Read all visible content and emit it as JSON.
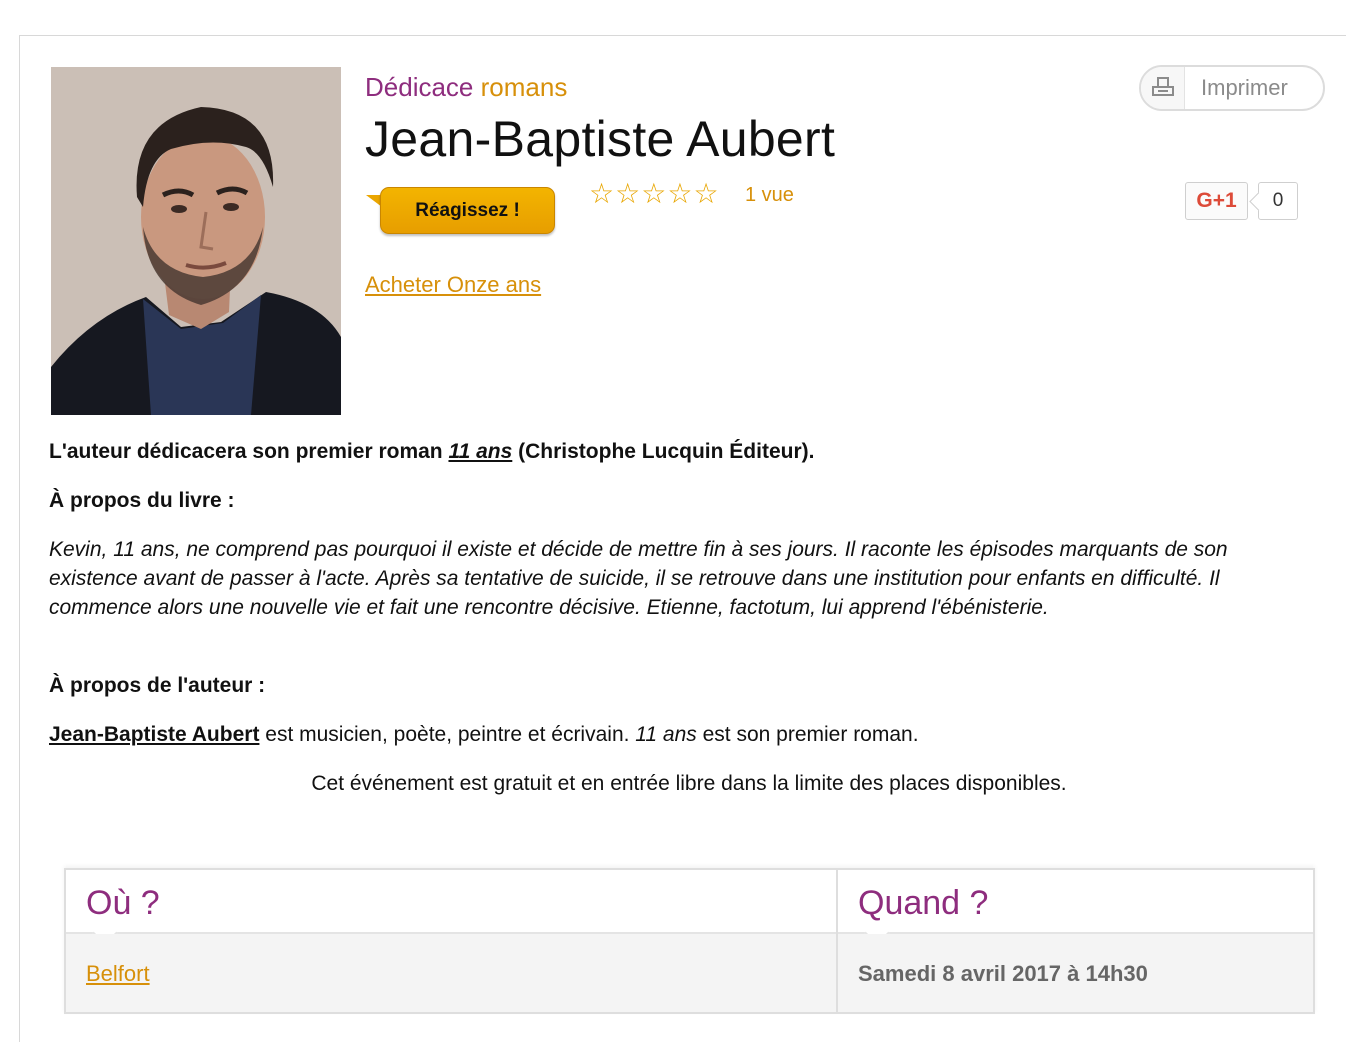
{
  "event": {
    "category_word1": "Dédicace",
    "category_word2": "romans",
    "title": "Jean-Baptiste Aubert",
    "react_label": "Réagissez !",
    "rating_stars": 5,
    "rating_filled": 0,
    "views_label": "1 vue",
    "buy_link": "Acheter Onze ans",
    "print_label": "Imprimer",
    "gplus_label": "G+1",
    "gplus_count": "0"
  },
  "content": {
    "intro_prefix": "L'auteur dédicacera son premier roman ",
    "intro_book": "11 ans",
    "intro_suffix": " (Christophe Lucquin Éditeur).",
    "about_book_heading": "À propos du livre :",
    "synopsis": "Kevin, 11 ans, ne comprend pas pourquoi il existe et décide de mettre fin à ses jours. Il raconte les épisodes marquants de son existence avant de passer à l'acte. Après sa tentative de suicide, il se retrouve dans une institution pour enfants en difficulté. Il commence alors une nouvelle vie et fait une rencontre décisive. Etienne, factotum, lui apprend l'ébénisterie.",
    "about_author_heading": "À propos de l'auteur :",
    "bio_author": "Jean-Baptiste Aubert",
    "bio_middle": " est musicien, poète, peintre et écrivain. ",
    "bio_book": "11 ans",
    "bio_suffix": " est son premier roman.",
    "free_notice": "Cet événement est gratuit et en entrée libre dans la limite des places disponibles."
  },
  "info": {
    "where_heading": "Où ?",
    "where_value": "Belfort",
    "when_heading": "Quand ?",
    "when_value": "Samedi 8 avril 2017 à 14h30"
  },
  "colors": {
    "accent_purple": "#8e2d7e",
    "accent_orange": "#d7900a",
    "button_orange": "#f3b400",
    "gplus_red": "#dd4b39"
  },
  "icons": [
    "printer-icon",
    "star-icon",
    "author-photo"
  ]
}
